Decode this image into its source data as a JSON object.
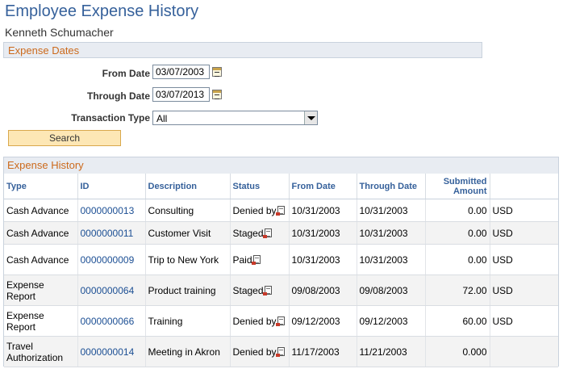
{
  "page": {
    "title": "Employee Expense History",
    "employee_name": "Kenneth Schumacher"
  },
  "expense_dates": {
    "section_title": "Expense Dates",
    "from_date_label": "From Date",
    "from_date_value": "03/07/2003",
    "through_date_label": "Through Date",
    "through_date_value": "03/07/2013",
    "transaction_type_label": "Transaction Type",
    "transaction_type_value": "All",
    "search_label": "Search"
  },
  "history": {
    "title": "Expense History",
    "columns": {
      "type": "Type",
      "id": "ID",
      "description": "Description",
      "status": "Status",
      "from_date": "From Date",
      "through_date": "Through Date",
      "amount_line1": "Submitted",
      "amount_line2": "Amount"
    },
    "rows": [
      {
        "type": "Cash Advance",
        "id": "0000000013",
        "description": "Consulting",
        "status": "Denied by",
        "from": "10/31/2003",
        "through": "10/31/2003",
        "amount": "0.00",
        "currency": "USD"
      },
      {
        "type": "Cash Advance",
        "id": "0000000011",
        "description": "Customer Visit",
        "status": "Staged",
        "from": "10/31/2003",
        "through": "10/31/2003",
        "amount": "0.00",
        "currency": "USD"
      },
      {
        "type": "Cash Advance",
        "id": "0000000009",
        "description": "Trip to New York",
        "status": "Paid",
        "from": "10/31/2003",
        "through": "10/31/2003",
        "amount": "0.00",
        "currency": "USD"
      },
      {
        "type": "Expense Report",
        "id": "0000000064",
        "description": "Product training",
        "status": "Staged",
        "from": "09/08/2003",
        "through": "09/08/2003",
        "amount": "72.00",
        "currency": "USD"
      },
      {
        "type": "Expense Report",
        "id": "0000000066",
        "description": "Training",
        "status": "Denied by",
        "from": "09/12/2003",
        "through": "09/12/2003",
        "amount": "60.00",
        "currency": "USD"
      },
      {
        "type_line1": "Travel",
        "type_line2": "Authorization",
        "id": "0000000014",
        "description": "Meeting in Akron",
        "status": "Denied by",
        "from": "11/17/2003",
        "through": "11/21/2003",
        "amount": "0.000",
        "currency": ""
      }
    ]
  }
}
